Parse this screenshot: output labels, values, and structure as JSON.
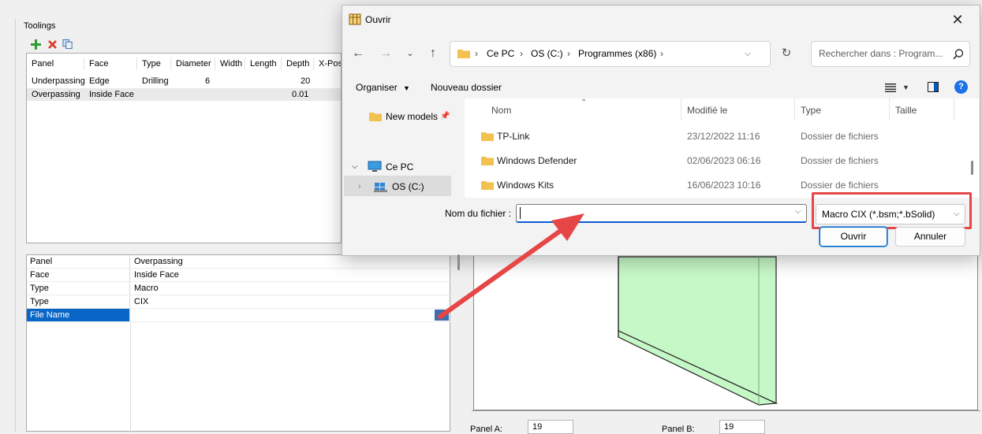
{
  "app": {
    "toolings_label": "Toolings",
    "tool_table": {
      "columns": [
        "Panel",
        "Face",
        "Type",
        "Diameter",
        "Width",
        "Length",
        "Depth",
        "X-Posi"
      ],
      "rows": [
        [
          "Underpassing",
          "Edge",
          "Drilling",
          "6",
          "",
          "",
          "20",
          ""
        ],
        [
          "Overpassing",
          "Inside Face",
          "",
          "",
          "",
          "",
          "0.01",
          ""
        ]
      ]
    },
    "properties": [
      {
        "key": "Panel",
        "value": "Overpassing"
      },
      {
        "key": "Face",
        "value": "Inside Face"
      },
      {
        "key": "Type",
        "value": "Macro"
      },
      {
        "key": "Type",
        "value": "CIX"
      },
      {
        "key": "File Name",
        "value": ""
      }
    ],
    "ellipsis": "...",
    "panel_a_label": "Panel A:",
    "panel_a_value": "19",
    "panel_b_label": "Panel B:",
    "panel_b_value": "19"
  },
  "dialog": {
    "title": "Ouvrir",
    "breadcrumb": [
      "Ce PC",
      "OS (C:)",
      "Programmes (x86)"
    ],
    "search_placeholder": "Rechercher dans : Program...",
    "organize_label": "Organiser",
    "new_folder_label": "Nouveau dossier",
    "nav_pane": {
      "quick_item": "New models",
      "this_pc": "Ce PC",
      "drive": "OS (C:)"
    },
    "columns": {
      "name": "Nom",
      "modified": "Modifié le",
      "type": "Type",
      "size": "Taille"
    },
    "files": [
      {
        "name": "TP-Link",
        "modified": "23/12/2022 11:16",
        "type": "Dossier de fichiers"
      },
      {
        "name": "Windows Defender",
        "modified": "02/06/2023 06:16",
        "type": "Dossier de fichiers"
      },
      {
        "name": "Windows Kits",
        "modified": "16/06/2023 10:16",
        "type": "Dossier de fichiers"
      }
    ],
    "filename_label": "Nom du fichier :",
    "filename_value": "",
    "filter_value": "Macro CIX (*.bsm;*.bSolid)",
    "open_button": "Ouvrir",
    "cancel_button": "Annuler"
  },
  "colors": {
    "accent": "#0067c0",
    "selection": "#0a66c6",
    "highlight_box": "#e64646",
    "preview_fill": "#c6f7c6",
    "folder": "#f2c14e"
  }
}
